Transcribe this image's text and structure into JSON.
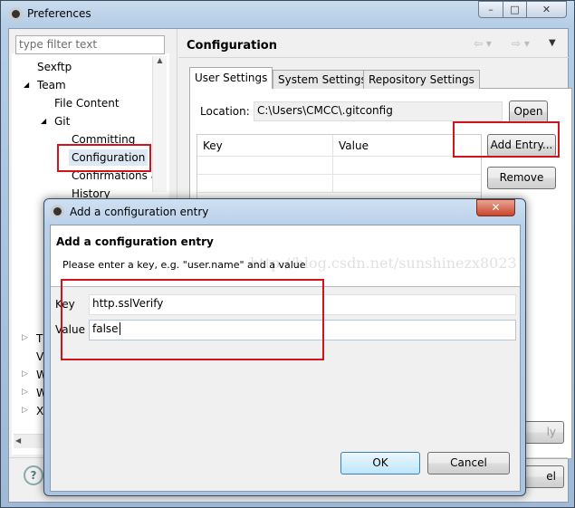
{
  "window": {
    "title": "Preferences"
  },
  "sidebar": {
    "filter_placeholder": "type filter text",
    "items": [
      {
        "label": "Sexftp",
        "level": 0
      },
      {
        "label": "Team",
        "level": 0,
        "expanded": true
      },
      {
        "label": "File Content",
        "level": 1
      },
      {
        "label": "Git",
        "level": 1,
        "expanded": true
      },
      {
        "label": "Committing",
        "level": 2
      },
      {
        "label": "Configuration",
        "level": 2,
        "selected": true
      },
      {
        "label": "Confirmations a",
        "level": 2
      },
      {
        "label": "History",
        "level": 2
      }
    ],
    "partial_items": [
      "T",
      "V",
      "W",
      "W",
      "X"
    ]
  },
  "main": {
    "title": "Configuration",
    "tabs": [
      {
        "label": "User Settings",
        "active": true
      },
      {
        "label": "System Settings"
      },
      {
        "label": "Repository Settings"
      }
    ],
    "location_label": "Location:",
    "location_value": "C:\\Users\\CMCC\\.gitconfig",
    "open_label": "Open",
    "table_headers": [
      "Key",
      "Value"
    ],
    "add_entry_label": "Add Entry...",
    "remove_label": "Remove",
    "apply_partial": "ly",
    "cancel_partial": "el"
  },
  "dialog": {
    "title": "Add a configuration entry",
    "heading": "Add a configuration entry",
    "description": "Please enter a key, e.g. \"user.name\" and a value",
    "key_label": "Key",
    "key_value": "http.sslVerify",
    "value_label": "Value",
    "value_value": "false",
    "ok_label": "OK",
    "cancel_label": "Cancel"
  },
  "watermark": "http://blog.csdn.net/sunshinezx8023",
  "colors": {
    "highlight": "#d0141b",
    "selection": "#dde8f3"
  }
}
